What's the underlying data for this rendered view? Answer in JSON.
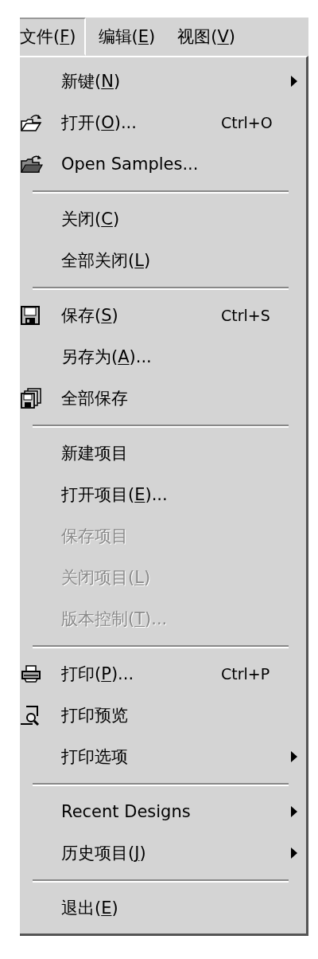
{
  "menubar": [
    {
      "text": "文件(",
      "key": "F",
      "rest": ")",
      "selected": true
    },
    {
      "text": "编辑(",
      "key": "E",
      "rest": ")",
      "selected": false
    },
    {
      "text": "视图(",
      "key": "V",
      "rest": ")",
      "selected": false
    }
  ],
  "menu": [
    {
      "kind": "plain",
      "text": "新键(",
      "key": "N",
      "rest": ")",
      "submenu": true,
      "disabled": false
    },
    {
      "kind": "open",
      "text": "打开(",
      "key": "O",
      "rest": ")...",
      "shortcut": "Ctrl+O",
      "submenu": false,
      "disabled": false
    },
    {
      "kind": "samples",
      "text": "Open Samples...",
      "submenu": false,
      "disabled": false
    },
    {
      "kind": "separator"
    },
    {
      "kind": "plain",
      "text": "关闭(",
      "key": "C",
      "rest": ")",
      "submenu": false,
      "disabled": false
    },
    {
      "kind": "plain",
      "text": "全部关闭(",
      "key": "L",
      "rest": ")",
      "submenu": false,
      "disabled": false
    },
    {
      "kind": "separator"
    },
    {
      "kind": "save",
      "text": "保存(",
      "key": "S",
      "rest": ")",
      "shortcut": "Ctrl+S",
      "submenu": false,
      "disabled": false
    },
    {
      "kind": "plain",
      "text": "另存为(",
      "key": "A",
      "rest": ")...",
      "submenu": false,
      "disabled": false
    },
    {
      "kind": "saveall",
      "text": "全部保存",
      "submenu": false,
      "disabled": false
    },
    {
      "kind": "separator"
    },
    {
      "kind": "plain",
      "text": "新建项目",
      "submenu": false,
      "disabled": false
    },
    {
      "kind": "plain",
      "text": "打开项目(",
      "key": "E",
      "rest": ")...",
      "submenu": false,
      "disabled": false
    },
    {
      "kind": "plain",
      "text": "保存项目",
      "submenu": false,
      "disabled": true
    },
    {
      "kind": "plain",
      "text": "关闭项目(",
      "key": "L",
      "rest": ")",
      "submenu": false,
      "disabled": true
    },
    {
      "kind": "plain",
      "text": "版本控制(",
      "key": "T",
      "rest": ")...",
      "submenu": false,
      "disabled": true
    },
    {
      "kind": "separator"
    },
    {
      "kind": "print",
      "text": "打印(",
      "key": "P",
      "rest": ")...",
      "shortcut": "Ctrl+P",
      "submenu": false,
      "disabled": false
    },
    {
      "kind": "preview",
      "text": "打印预览",
      "submenu": false,
      "disabled": false
    },
    {
      "kind": "plain",
      "text": "打印选项",
      "submenu": true,
      "disabled": false
    },
    {
      "kind": "separator"
    },
    {
      "kind": "plain",
      "text": "Recent Designs",
      "submenu": true,
      "disabled": false
    },
    {
      "kind": "plain",
      "text": "历史项目(",
      "key": "J",
      "rest": ")",
      "submenu": true,
      "disabled": false
    },
    {
      "kind": "separator"
    },
    {
      "kind": "plain",
      "text": "退出(",
      "key": "E",
      "rest": ")",
      "submenu": false,
      "disabled": false
    }
  ]
}
